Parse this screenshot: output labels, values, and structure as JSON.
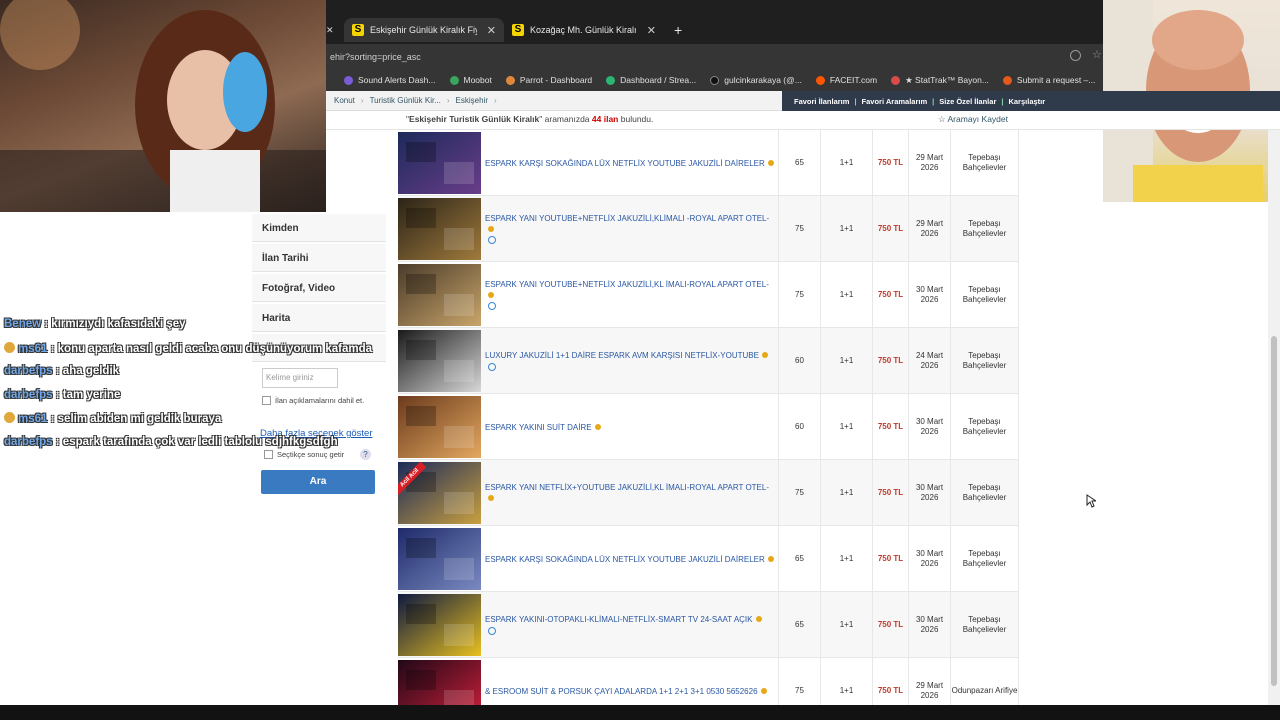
{
  "browser": {
    "tabs": [
      {
        "title": "Eskişehir Günlük Kiralık Fiyatları",
        "favicon": "S",
        "active": true
      },
      {
        "title": "Kozağaç Mh. Günlük Kiralık Stüdy...",
        "favicon": "S",
        "active": false
      }
    ],
    "new_tab_label": "+",
    "address": "ehir?sorting=price_asc",
    "bookmarks": [
      {
        "label": "Sound Alerts Dash...",
        "color": "#7b5cd6"
      },
      {
        "label": "Moobot",
        "color": "#3aa55c"
      },
      {
        "label": "Parrot - Dashboard",
        "color": "#e0883a"
      },
      {
        "label": "Dashboard / Strea...",
        "color": "#2bb673"
      },
      {
        "label": "gulcinkarakaya (@...",
        "color": "#111111"
      },
      {
        "label": "FACEIT.com",
        "color": "#ff5500"
      },
      {
        "label": "★ StatTrak™ Bayon...",
        "color": "#d94b4b"
      },
      {
        "label": "Submit a request –...",
        "color": "#e25a1c"
      }
    ]
  },
  "breadcrumb": [
    "Konut",
    "Turistik Günlük Kir...",
    "Eskişehir"
  ],
  "user_links": [
    "Favori İlanlarım",
    "Favori Aramalarım",
    "Size Özel İlanlar",
    "Karşılaştır"
  ],
  "results": {
    "query": "Eskişehir Turistik Günlük Kiralık",
    "mid_text": "aramanızda",
    "count": "44 ilan",
    "suffix": "bulundu.",
    "save_search": "☆ Aramayı Kaydet"
  },
  "filters": {
    "items": [
      "Kimden",
      "İlan Tarihi",
      "Fotoğraf, Video",
      "Harita"
    ],
    "keyword_placeholder": "Kelime giriniz",
    "description_checkbox": "İlan açıklamalarını dahil et.",
    "more_link": "Daha fazla seçenek göster",
    "auto_results": "Seçtikçe sonuç getir",
    "search_button": "Ara"
  },
  "listings": [
    {
      "title": "ESPARK KARŞI SOKAĞINDA LÜX NETFLİX YOUTUBE JAKUZİLİ DAİRELER",
      "m2": "65",
      "rooms": "1+1",
      "price": "750 TL",
      "date": "29 Mart 2026",
      "location": "Tepebaşı Bahçelievler",
      "video": false,
      "thumb": [
        "#1c2a5a",
        "#6a3d8a"
      ]
    },
    {
      "title": "ESPARK YANI YOUTUBE+NETFLİX JAKUZİLİ,KLİMALI -ROYAL APART OTEL-",
      "m2": "75",
      "rooms": "1+1",
      "price": "750 TL",
      "date": "29 Mart 2026",
      "location": "Tepebaşı Bahçelievler",
      "video": true,
      "thumb": [
        "#2b2418",
        "#a07a3c"
      ]
    },
    {
      "title": "ESPARK YANI YOUTUBE+NETFLİX JAKUZİLİ,KL İMALI-ROYAL APART OTEL-",
      "m2": "75",
      "rooms": "1+1",
      "price": "750 TL",
      "date": "30 Mart 2026",
      "location": "Tepebaşı Bahçelievler",
      "video": true,
      "thumb": [
        "#4a3b2a",
        "#c9a56a"
      ]
    },
    {
      "title": "LUXURY JAKUZİLİ 1+1 DAİRE ESPARK AVM KARŞISI NETFLİX-YOUTUBE",
      "m2": "60",
      "rooms": "1+1",
      "price": "750 TL",
      "date": "24 Mart 2026",
      "location": "Tepebaşı Bahçelievler",
      "video": true,
      "thumb": [
        "#1a1a1a",
        "#d8d8d8"
      ]
    },
    {
      "title": "ESPARK YAKINI SUİT DAİRE",
      "m2": "60",
      "rooms": "1+1",
      "price": "750 TL",
      "date": "30 Mart 2026",
      "location": "Tepebaşı Bahçelievler",
      "video": false,
      "thumb": [
        "#6b3a1c",
        "#e3a860"
      ]
    },
    {
      "title": "ESPARK YANI NETFLİX+YOUTUBE JAKUZİLİ,KL İMALI-ROYAL APART OTEL-",
      "m2": "75",
      "rooms": "1+1",
      "price": "750 TL",
      "date": "30 Mart 2026",
      "location": "Tepebaşı Bahçelievler",
      "video": false,
      "badge": "Acil Acil",
      "thumb": [
        "#1c2a5a",
        "#c9a040"
      ]
    },
    {
      "title": "ESPARK KARŞI SOKAĞINDA LÜX NETFLİX YOUTUBE JAKUZİLİ DAİRELER",
      "m2": "65",
      "rooms": "1+1",
      "price": "750 TL",
      "date": "30 Mart 2026",
      "location": "Tepebaşı Bahçelievler",
      "video": false,
      "thumb": [
        "#1e2a6a",
        "#7a8ac0"
      ]
    },
    {
      "title": "ESPARK YAKINI-OTOPAKLI-KLİMALI-NETFLİX-SMART TV 24-SAAT AÇIK",
      "m2": "65",
      "rooms": "1+1",
      "price": "750 TL",
      "date": "30 Mart 2026",
      "location": "Tepebaşı Bahçelievler",
      "video": true,
      "thumb": [
        "#0e1840",
        "#e8c020"
      ]
    },
    {
      "title": "& ESROOM SUİT & PORSUK ÇAYI ADALARDA 1+1 2+1 3+1 0530 5652626",
      "m2": "75",
      "rooms": "1+1",
      "price": "750 TL",
      "date": "29 Mart 2026",
      "location": "Odunpazarı Arifiye",
      "video": false,
      "thumb": [
        "#200818",
        "#d0203a"
      ]
    }
  ],
  "chat": [
    {
      "user": "Benew",
      "message": ": kırmızıydı kafasıdaki şey",
      "emote": false
    },
    {
      "user": "ms61",
      "message": ": konu aparta nasıl geldi acaba onu düşünüyorum kafamda",
      "emote": true
    },
    {
      "user": "darbefps",
      "message": ": aha geldik",
      "emote": false
    },
    {
      "user": "darbefps",
      "message": ": tam yerine",
      "emote": false
    },
    {
      "user": "ms61",
      "message": ": selim abiden mi geldik buraya",
      "emote": true
    },
    {
      "user": "darbefps",
      "message": ": espark tarafında çok var ledli tablolu sdjhfkgsdfgh",
      "emote": false
    }
  ],
  "colors": {
    "price": "#c0392b",
    "link": "#2957a4",
    "user_bar": "#2f3a4a",
    "search_button": "#3a7ac0",
    "chat_user": "#6fa7e8"
  }
}
